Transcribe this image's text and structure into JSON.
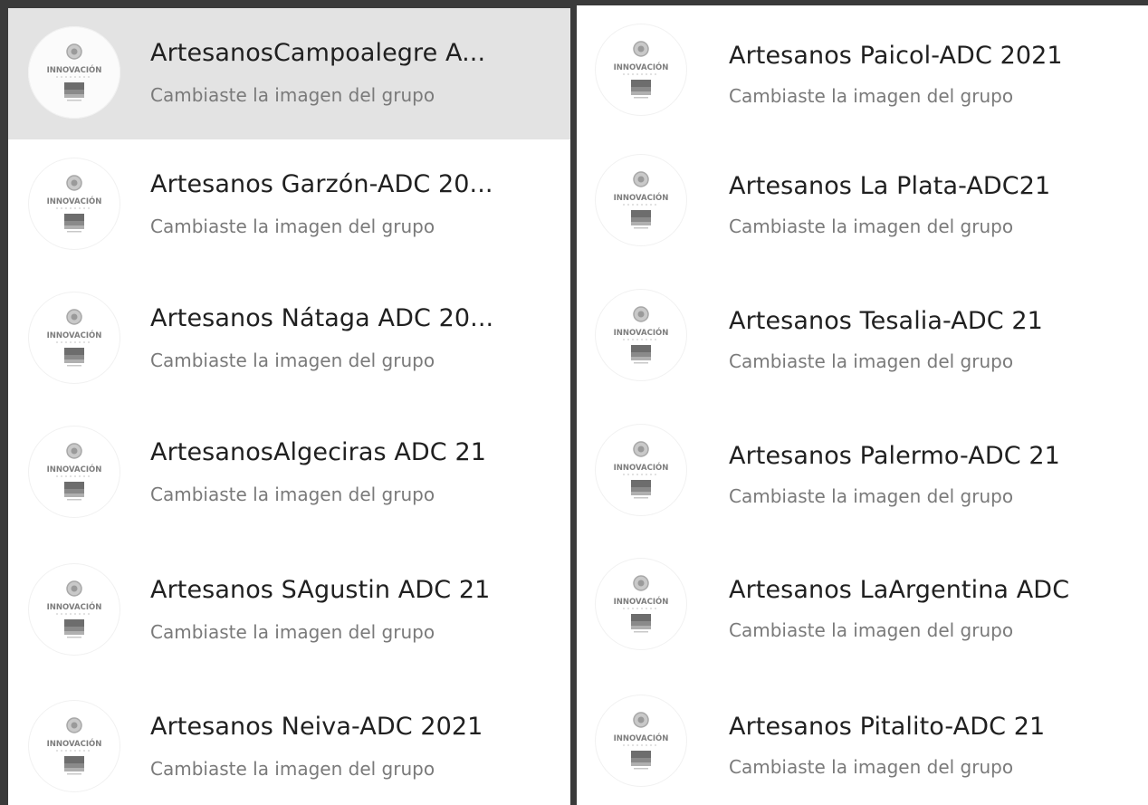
{
  "left_column": [
    {
      "name": "ArtesanosCampoalegre A...",
      "status": "Cambiaste la imagen del grupo",
      "selected": true
    },
    {
      "name": "Artesanos Garzón-ADC 20...",
      "status": "Cambiaste la imagen del grupo"
    },
    {
      "name": "Artesanos Nátaga ADC 20...",
      "status": "Cambiaste la imagen del grupo"
    },
    {
      "name": "ArtesanosAlgeciras ADC 21",
      "status": "Cambiaste la imagen del grupo"
    },
    {
      "name": "Artesanos SAgustin ADC 21",
      "status": "Cambiaste la imagen del grupo"
    },
    {
      "name": "Artesanos Neiva-ADC 2021",
      "status": "Cambiaste la imagen del grupo"
    }
  ],
  "right_column": [
    {
      "name": "Artesanos Paicol-ADC 2021",
      "status": "Cambiaste la imagen del grupo"
    },
    {
      "name": "Artesanos La Plata-ADC21",
      "status": "Cambiaste la imagen del grupo"
    },
    {
      "name": "Artesanos Tesalia-ADC 21",
      "status": "Cambiaste la imagen del grupo"
    },
    {
      "name": "Artesanos Palermo-ADC 21",
      "status": "Cambiaste la imagen del grupo"
    },
    {
      "name": "Artesanos LaArgentina ADC",
      "status": "Cambiaste la imagen del grupo"
    },
    {
      "name": "Artesanos Pitalito-ADC 21",
      "status": "Cambiaste la imagen del grupo"
    }
  ],
  "avatar": {
    "logo_text": "INNOVACIÓN",
    "icon": "group-avatar-icon"
  },
  "colors": {
    "background": "#3a3a3a",
    "panel": "#ffffff",
    "selected_row": "#e3e3e3",
    "name_text": "#202020",
    "status_text": "#7a7a7a"
  }
}
